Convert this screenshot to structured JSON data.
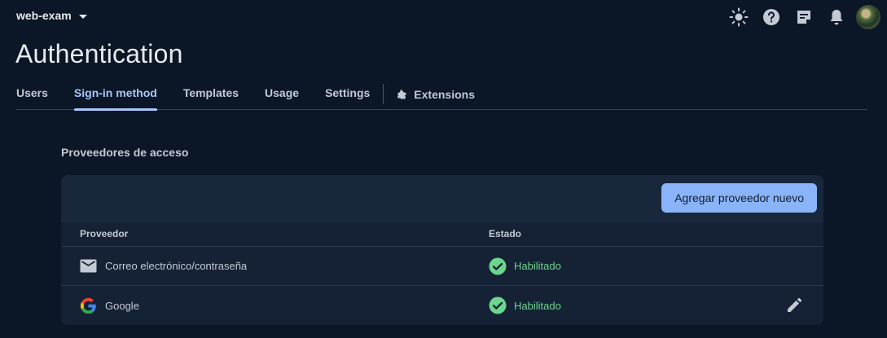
{
  "header": {
    "project_name": "web-exam",
    "icons": [
      "brightness-icon",
      "help-icon",
      "notes-icon",
      "notifications-icon",
      "avatar"
    ]
  },
  "page": {
    "title": "Authentication"
  },
  "tabs": [
    {
      "label": "Users",
      "active": false
    },
    {
      "label": "Sign-in method",
      "active": true
    },
    {
      "label": "Templates",
      "active": false
    },
    {
      "label": "Usage",
      "active": false
    },
    {
      "label": "Settings",
      "active": false
    },
    {
      "label": "Extensions",
      "active": false
    }
  ],
  "providers": {
    "section_title": "Proveedores de acceso",
    "add_button_label": "Agregar proveedor nuevo",
    "columns": [
      "Proveedor",
      "Estado"
    ],
    "rows": [
      {
        "name": "Correo electrónico/contraseña",
        "icon": "email-icon",
        "status": "Habilitado"
      },
      {
        "name": "Google",
        "icon": "google-icon",
        "status": "Habilitado"
      }
    ]
  },
  "colors": {
    "background": "#0b1626",
    "accent": "#a8c7fa",
    "button": "#8ab4f8",
    "enabled": "#6dd58c"
  }
}
